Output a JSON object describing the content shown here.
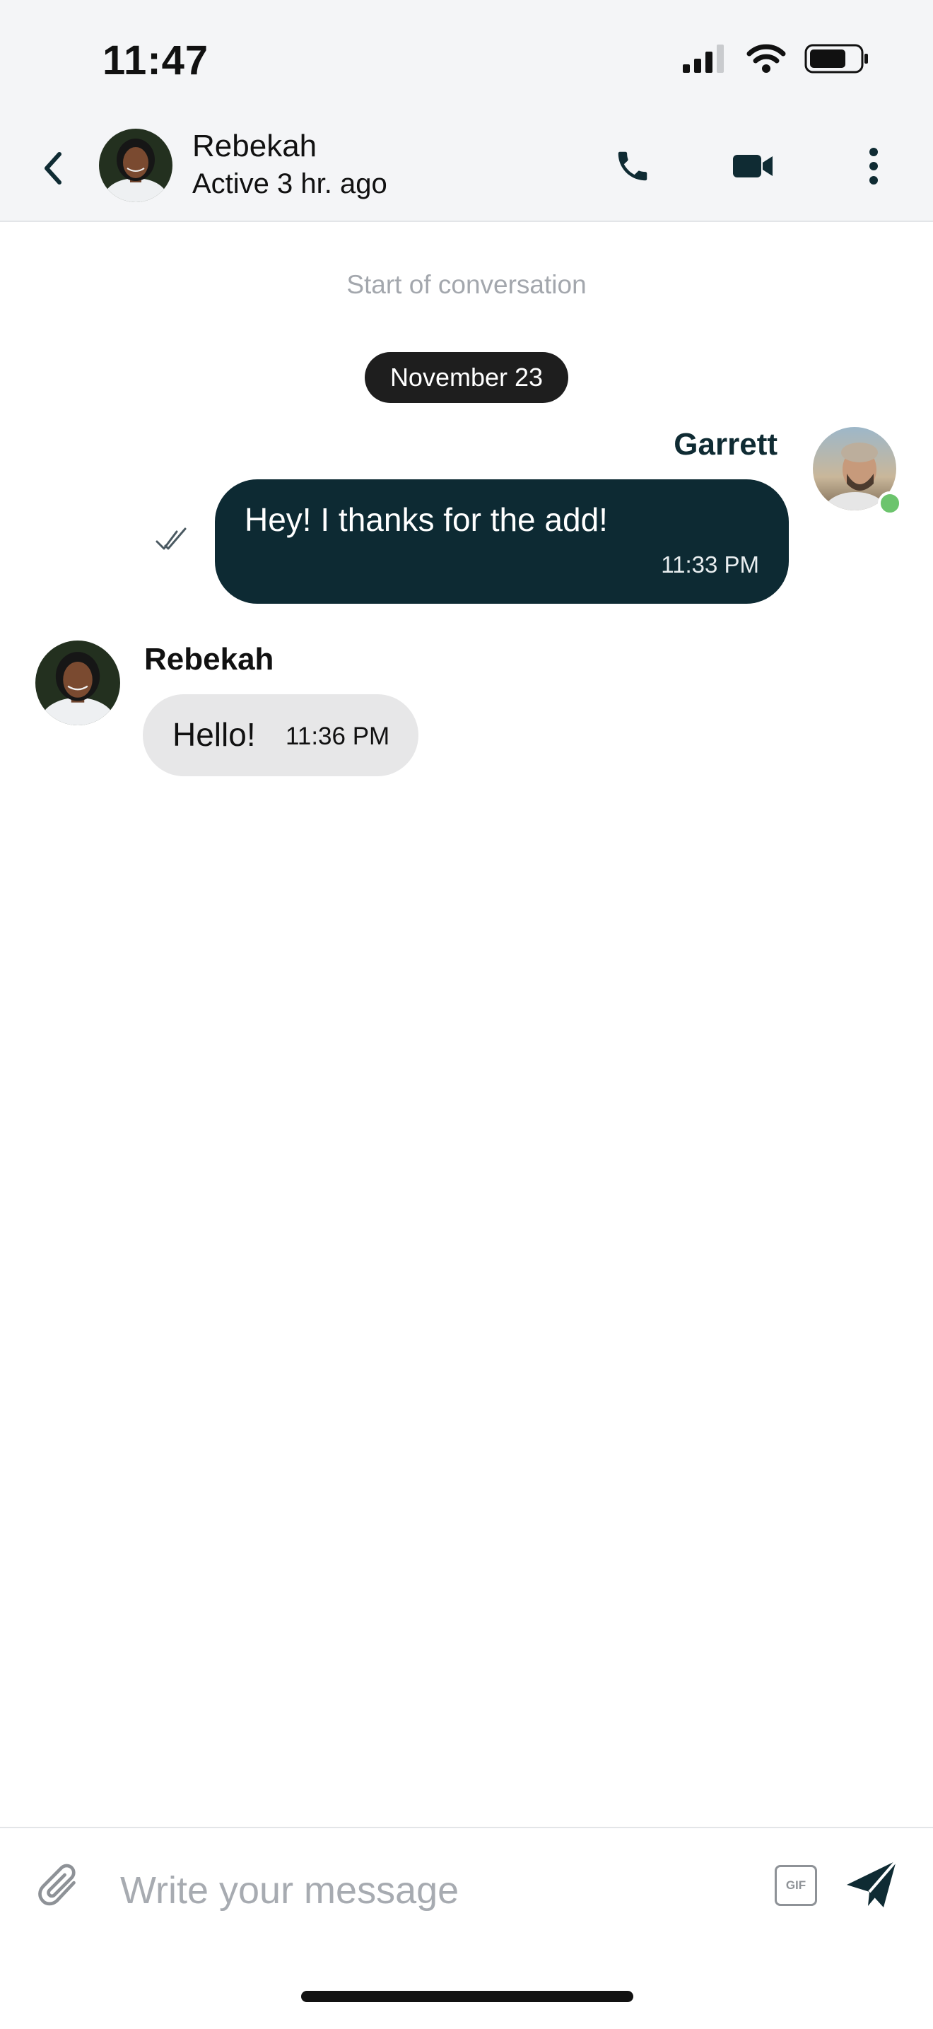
{
  "status_bar": {
    "time": "11:47"
  },
  "header": {
    "contact_name": "Rebekah",
    "contact_status": "Active 3 hr. ago"
  },
  "conversation": {
    "start_label": "Start of conversation",
    "date_label": "November 23",
    "messages": [
      {
        "sender": "Garrett",
        "text": "Hey! I thanks for the add!",
        "time": "11:33 PM",
        "direction": "outgoing",
        "read": true
      },
      {
        "sender": "Rebekah",
        "text": "Hello!",
        "time": "11:36 PM",
        "direction": "incoming"
      }
    ]
  },
  "composer": {
    "placeholder": "Write your message",
    "gif_label": "GIF"
  },
  "colors": {
    "accent": "#0d2a33",
    "online": "#6cc46d",
    "incoming_bubble": "#e7e7e8"
  }
}
